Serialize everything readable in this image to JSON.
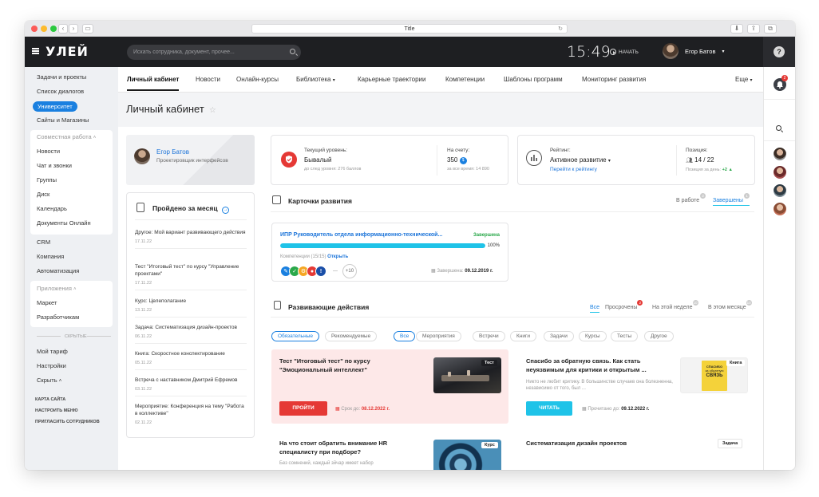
{
  "window": {
    "title": "Title"
  },
  "topbar": {
    "logo": "УЛЕЙ",
    "search_placeholder": "Искать сотрудника, документ, прочее...",
    "clock": "15:49",
    "start_label": "НАЧАТЬ",
    "user_name": "Егор Батов",
    "help": "?"
  },
  "sidebar": {
    "top_items": [
      "Задачи и проекты",
      "Список диалогов",
      "Университет",
      "Сайты и Магазины"
    ],
    "collab_head": "Совместная работа",
    "collab_items": [
      "Новости",
      "Чат и звонки",
      "Группы",
      "Диск",
      "Календарь",
      "Документы Онлайн"
    ],
    "mid_items": [
      "CRM",
      "Компания",
      "Автоматизация"
    ],
    "apps_head": "Приложения",
    "apps_items": [
      "Маркет",
      "Разработчикам"
    ],
    "hidden_label": "скрытые",
    "bottom_items": [
      "Мой тариф",
      "Настройки",
      "Скрыть"
    ],
    "small_links": [
      "Карта сайта",
      "Настроить меню",
      "Пригласить сотрудников"
    ]
  },
  "nav": {
    "tabs": [
      "Личный кабинет",
      "Новости",
      "Онлайн-курсы",
      "Библиотека",
      "Карьерные траектории",
      "Компетенции",
      "Шаблоны программ",
      "Мониторинг развития"
    ],
    "more": "Еще"
  },
  "rightbar": {
    "bell_count": "2"
  },
  "page": {
    "title": "Личный кабинет"
  },
  "profile": {
    "name": "Егор Батов",
    "role": "Проектировщик интерфейсов"
  },
  "month": {
    "title": "Пройдено за месяц",
    "items": [
      {
        "text": "Другое: Мой вариант развивающего действия",
        "date": "17.11.22"
      },
      {
        "text": "Тест \"Итоговый тест\" по курсу \"Управление проектами\"",
        "date": "17.11.22"
      },
      {
        "text": "Курс: Целеполагание",
        "date": "13.11.22"
      },
      {
        "text": "Задача: Систематизация дизайн-проектов",
        "date": "06.11.22"
      },
      {
        "text": "Книга: Скоростное конспектирование",
        "date": "05.11.22"
      },
      {
        "text": "Встреча с наставником Дмитрий Ефремов",
        "date": "03.11.22"
      },
      {
        "text": "Мероприятие: Конференция на тему \"Работа в коллективе\"",
        "date": "02.11.22"
      }
    ]
  },
  "level": {
    "label": "Текущий уровень:",
    "value": "Бывалый",
    "next": "до след уровня: 276 баллов",
    "account_label": "На счету:",
    "account_value": "350",
    "time_label": "за все время: 14 890"
  },
  "rating": {
    "label": "Рейтинг:",
    "value": "Активное развитие",
    "link": "Перейти к рейтингу",
    "position_label": "Позиция:",
    "position_value": "14 / 22",
    "day_label": "Позиция за день:",
    "day_value": "+2"
  },
  "dev_cards": {
    "title": "Карточки развития",
    "tab_inwork": "В работе",
    "tab_inwork_count": "2",
    "tab_done": "Завершены",
    "tab_done_count": "1",
    "card": {
      "title": "ИПР Руководитель отдела информационно-технической...",
      "status": "Завершена",
      "progress": 100,
      "progress_label": "100%",
      "competencies": "Компетенции (15/15)",
      "open": "Открыть",
      "more": "+10",
      "finished_label": "Завершена:",
      "finished_date": "09.12.2019 г."
    }
  },
  "actions": {
    "title": "Развивающие действия",
    "tabs": [
      {
        "label": "Все",
        "count": ""
      },
      {
        "label": "Просрочены",
        "count": "2"
      },
      {
        "label": "На этой неделе",
        "count": "10"
      },
      {
        "label": "В этом месяце",
        "count": "10"
      }
    ],
    "filters_left": [
      "Обязательные",
      "Рекомендуемые"
    ],
    "filters_right": [
      "Все",
      "Мероприятия",
      "Встречи",
      "Книги",
      "Задачи",
      "Курсы",
      "Тесты",
      "Другое"
    ],
    "items": [
      {
        "title": "Тест \"Итоговый тест\" по курсу \"Эмоциональный интеллект\"",
        "tag": "Тест",
        "button": "ПРОЙТИ",
        "date_label": "Срок до:",
        "date": "08.12.2022 г."
      },
      {
        "title": "Спасибо за обратную связь. Как стать неуязвимым для критики и открытым ...",
        "desc": "Никто не любит критику. В большинстве случаев она болезненна, независимо от того, был ...",
        "tag": "Книга",
        "button": "ЧИТАТЬ",
        "date_label": "Прочитано до:",
        "date": "09.12.2022 г.",
        "book_word1": "СПАСИБО",
        "book_word2": "за обратную",
        "book_word3": "СВЯЗЬ"
      },
      {
        "title": "На что стоит обратить внимание HR специалисту при подборе?",
        "desc": "Без сомнений, каждый зйчар имеет набор",
        "tag": "Курс"
      },
      {
        "title": "Систематизация дизайн проектов",
        "tag": "Задача"
      }
    ]
  },
  "colors": {
    "accent": "#1a80e0",
    "danger": "#e53935",
    "success": "#2aa84a",
    "cyan": "#1fc3e8"
  }
}
